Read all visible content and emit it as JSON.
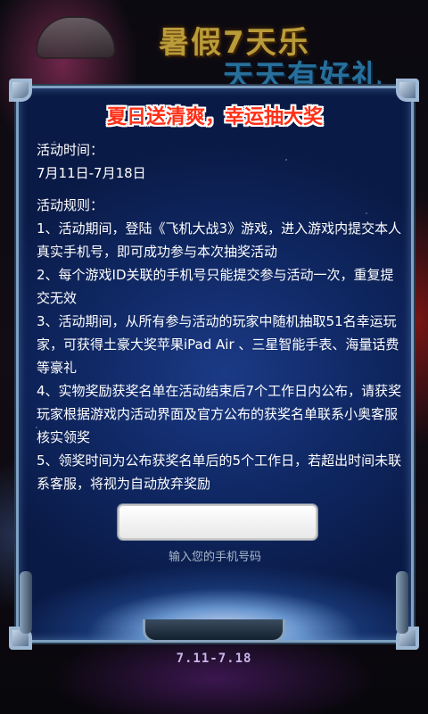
{
  "background": {
    "headline_line1": "暑假7天乐",
    "headline_line2": "天天有好礼",
    "bottom_date": "7.11-7.18"
  },
  "panel": {
    "title": "夏日送清爽，幸运抽大奖",
    "time_label": "活动时间：",
    "time_value": "7月11日-7月18日",
    "rules_label": "活动规则：",
    "rules": [
      "1、活动期间，登陆《飞机大战3》游戏，进入游戏内提交本人真实手机号，即可成功参与本次抽奖活动",
      "2、每个游戏ID关联的手机号只能提交参与活动一次，重复提交无效",
      "3、活动期间，从所有参与活动的玩家中随机抽取51名幸运玩家，可获得土豪大奖苹果iPad Air 、三星智能手表、海量话费等豪礼",
      "4、实物奖励获奖名单在活动结束后7个工作日内公布，请获奖玩家根据游戏内活动界面及官方公布的获奖名单联系小奥客服核实领奖",
      "5、领奖时间为公布获奖名单后的5个工作日，若超出时间未联系客服，将视为自动放弃奖励"
    ],
    "phone_input": {
      "value": "",
      "placeholder": ""
    },
    "phone_hint": "输入您的手机号码"
  },
  "colors": {
    "title_red": "#ff2f16",
    "panel_blue": "#0f2762",
    "frame_silver": "#7fa2c4"
  }
}
